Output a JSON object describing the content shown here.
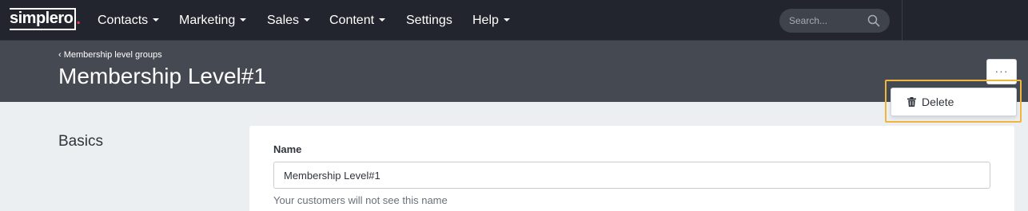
{
  "nav": {
    "logo_main": "simplero",
    "logo_dot": ".",
    "items": [
      {
        "label": "Contacts",
        "has_dropdown": true
      },
      {
        "label": "Marketing",
        "has_dropdown": true
      },
      {
        "label": "Sales",
        "has_dropdown": true
      },
      {
        "label": "Content",
        "has_dropdown": true
      },
      {
        "label": "Settings",
        "has_dropdown": false
      },
      {
        "label": "Help",
        "has_dropdown": true
      }
    ],
    "search_placeholder": "Search...",
    "search_icon": "search-icon"
  },
  "header": {
    "breadcrumb": "‹ Membership level groups",
    "title": "Membership Level#1",
    "more_label": "···"
  },
  "dropdown": {
    "items": [
      {
        "label": "Delete",
        "icon": "trash-icon"
      }
    ]
  },
  "content": {
    "section_title": "Basics",
    "name_label": "Name",
    "name_value": "Membership Level#1",
    "name_help": "Your customers will not see this name"
  },
  "colors": {
    "nav_bg": "#22252d",
    "header_bg": "#454951",
    "page_bg": "#eceff1",
    "highlight": "#f0b53d",
    "logo_dot": "#e8384f"
  }
}
